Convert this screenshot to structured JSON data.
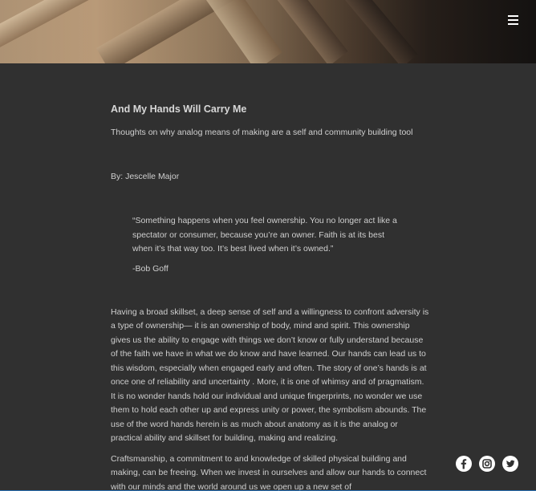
{
  "header": {
    "menu_icon": "hamburger-menu-icon"
  },
  "article": {
    "title": "And My Hands Will Carry Me",
    "subtitle": "Thoughts on why analog means of making are a self and community building tool",
    "byline": "By: Jescelle Major",
    "quote": {
      "line1": "“Something happens when you feel ownership. You no longer act like a",
      "line2": "spectator or consumer, because you’re an owner. Faith is at its best",
      "line3": "when it’s that way too. It’s best lived when it’s owned.”",
      "attribution": "-Bob Goff"
    },
    "paragraph1": "Having a broad skillset, a deep sense of self and a willingness to confront adversity is a type of ownership— it is an ownership of body, mind and spirit. This ownership gives us the ability to engage with things we don’t know or fully understand because of the faith we have in what we do know and have learned. Our hands can lead us to this wisdom, especially when engaged early and often. The story of one’s hands is at once one of reliability and uncertainty . More, it is one of whimsy and of pragmatism. It is no wonder hands hold our individual and unique fingerprints, no wonder we use them to hold each other up and express unity or power, the symbolism abounds.  The use of the word hands herein is as much about anatomy as it is the analog or practical ability and skillset for building, making and realizing.",
    "paragraph2": "Craftsmanship, a commitment to and knowledge of skilled physical building and making, can be freeing. When we invest in ourselves and allow our hands to connect with our minds and the world around us we open up a new set of"
  },
  "social": {
    "icons": [
      "facebook-icon",
      "instagram-icon",
      "twitter-icon"
    ]
  },
  "colors": {
    "background": "#303030",
    "text": "#cfcfcf",
    "icon": "#ffffff"
  }
}
